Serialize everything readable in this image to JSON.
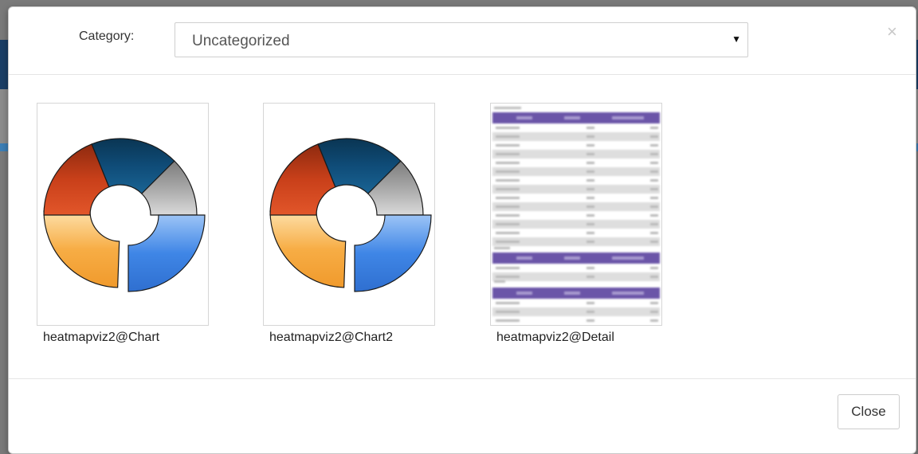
{
  "header": {
    "category_label": "Category:",
    "category_value": "Uncategorized",
    "close_glyph": "×"
  },
  "tiles": [
    {
      "label": "heatmapviz2@Chart",
      "thumbnail": "donut-chart-preview"
    },
    {
      "label": "heatmapviz2@Chart2",
      "thumbnail": "donut-chart-preview"
    },
    {
      "label": "heatmapviz2@Detail",
      "thumbnail": "table-detail-preview"
    }
  ],
  "footer": {
    "close_label": "Close"
  },
  "colors": {
    "slice_red": "#c9401a",
    "slice_navy": "#0f4c78",
    "slice_gray": "#a8a8a8",
    "slice_blue": "#3f86e6",
    "slice_orange": "#f7ad45",
    "table_header": "#6b55a8"
  }
}
